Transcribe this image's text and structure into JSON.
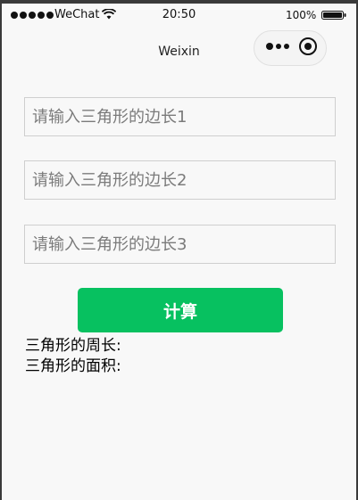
{
  "status_bar": {
    "carrier": "WeChat",
    "time": "20:50",
    "battery": "100%",
    "icons": [
      "signal-dots-icon",
      "wifi-icon",
      "battery-icon"
    ]
  },
  "nav": {
    "title": "Weixin",
    "capsule_icons": [
      "more-icon",
      "close-miniprogram-icon"
    ]
  },
  "form": {
    "side1_placeholder": "请输入三角形的边长1",
    "side2_placeholder": "请输入三角形的边长2",
    "side3_placeholder": "请输入三角形的边长3",
    "calculate_label": "计算"
  },
  "results": {
    "perimeter_label": "三角形的周长:",
    "area_label": "三角形的面积:"
  },
  "colors": {
    "accent": "#07c160",
    "page_background": "#f8f8f8"
  }
}
